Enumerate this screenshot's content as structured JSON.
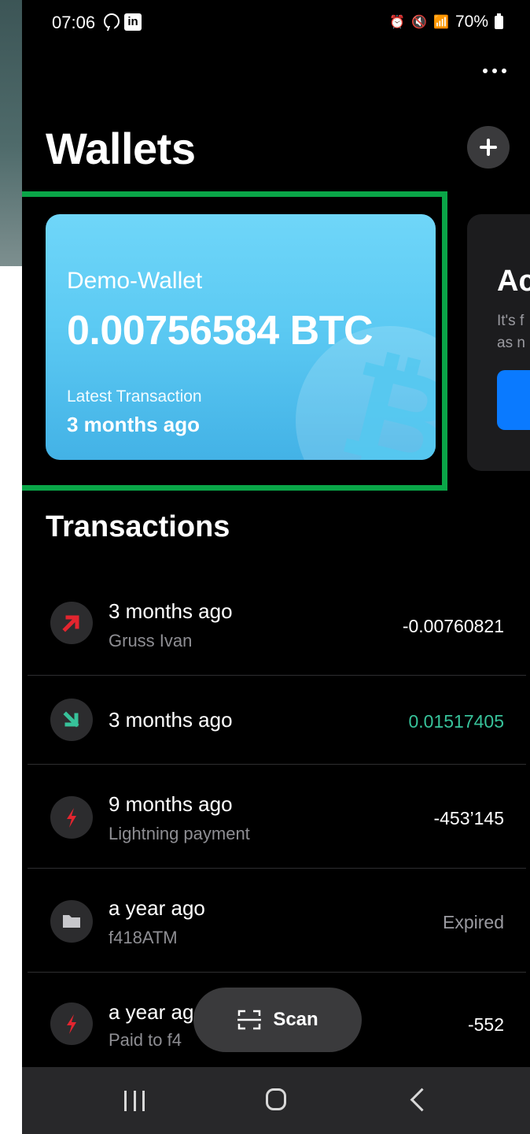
{
  "status_bar": {
    "time": "07:06",
    "battery": "70%",
    "network_label": "Vo) LTE1"
  },
  "header": {
    "title": "Wallets"
  },
  "wallet_card": {
    "name": "Demo-Wallet",
    "balance": "0.00756584 BTC",
    "latest_label": "Latest Transaction",
    "latest_value": "3 months ago",
    "gradient_top": "#6fd6f9",
    "gradient_bottom": "#43b2e6"
  },
  "next_card": {
    "title": "Ac",
    "desc_line1": "It's f",
    "desc_line2": "as n"
  },
  "transactions_title": "Transactions",
  "transactions": [
    {
      "when": "3 months ago",
      "desc": "Gruss Ivan",
      "amount": "-0.00760821",
      "icon": "arrow-up-right-icon",
      "amount_style": "negative"
    },
    {
      "when": "3 months ago",
      "desc": "",
      "amount": "0.01517405",
      "icon": "arrow-down-right-icon",
      "amount_style": "positive"
    },
    {
      "when": "9 months ago",
      "desc": "Lightning payment",
      "amount": "-453’145",
      "icon": "lightning-icon",
      "amount_style": "negative"
    },
    {
      "when": "a year ago",
      "desc": "f418ATM",
      "amount": "Expired",
      "icon": "folder-icon",
      "amount_style": "muted"
    },
    {
      "when": "a year ag",
      "desc": "Paid to f4",
      "amount": "-552",
      "icon": "lightning-icon",
      "amount_style": "negative"
    }
  ],
  "scan_button": {
    "label": "Scan"
  },
  "colors": {
    "highlight_border": "#0aa648",
    "outgoing": "#e3252f",
    "incoming": "#37c29a"
  }
}
